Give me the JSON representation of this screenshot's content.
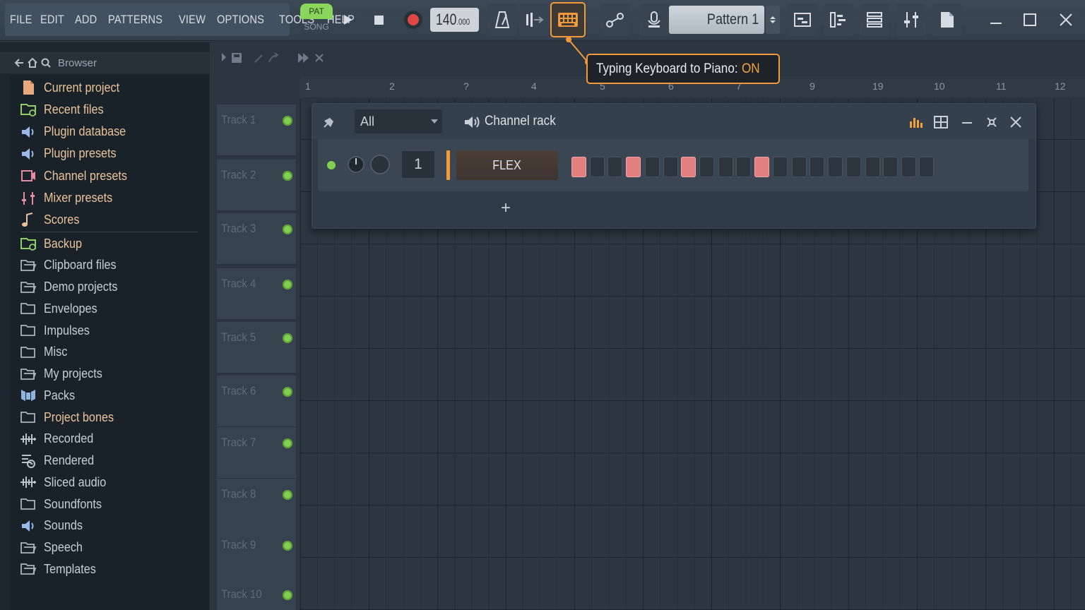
{
  "menu": [
    "FILE",
    "EDIT",
    "ADD",
    "PATTERNS",
    "VIEW",
    "OPTIONS",
    "TOOLS",
    "HELP"
  ],
  "transport": {
    "pat_label": "PAT",
    "song_label": "SONG",
    "tempo_main": "140",
    "tempo_decimal": ".000"
  },
  "pattern": {
    "name": "Pattern 1"
  },
  "hint": {
    "text": "Typing Keyboard to Piano:",
    "state": "ON"
  },
  "browser": {
    "title": "Browser",
    "items": [
      {
        "label": "Current project",
        "icon": "document-icon",
        "tone": "warm"
      },
      {
        "label": "Recent files",
        "icon": "folder-clock-icon",
        "tone": "warm"
      },
      {
        "label": "Plugin database",
        "icon": "speaker-icon",
        "tone": "warm"
      },
      {
        "label": "Plugin presets",
        "icon": "speaker-icon",
        "tone": "warm"
      },
      {
        "label": "Channel presets",
        "icon": "channel-icon",
        "tone": "warm"
      },
      {
        "label": "Mixer presets",
        "icon": "mixer-icon",
        "tone": "warm"
      },
      {
        "label": "Scores",
        "icon": "note-icon",
        "tone": "warm"
      },
      {
        "label": "Backup",
        "icon": "folder-clock-icon",
        "tone": "warm"
      },
      {
        "label": "Clipboard files",
        "icon": "folder-open-icon",
        "tone": "cool"
      },
      {
        "label": "Demo projects",
        "icon": "folder-open-icon",
        "tone": "cool"
      },
      {
        "label": "Envelopes",
        "icon": "folder-icon",
        "tone": "cool"
      },
      {
        "label": "Impulses",
        "icon": "folder-icon",
        "tone": "cool"
      },
      {
        "label": "Misc",
        "icon": "folder-icon",
        "tone": "cool"
      },
      {
        "label": "My projects",
        "icon": "folder-open-icon",
        "tone": "cool"
      },
      {
        "label": "Packs",
        "icon": "packs-icon",
        "tone": "cool"
      },
      {
        "label": "Project bones",
        "icon": "folder-icon",
        "tone": "warm"
      },
      {
        "label": "Recorded",
        "icon": "waveform-icon",
        "tone": "cool"
      },
      {
        "label": "Rendered",
        "icon": "render-icon",
        "tone": "cool"
      },
      {
        "label": "Sliced audio",
        "icon": "waveform-icon",
        "tone": "cool"
      },
      {
        "label": "Soundfonts",
        "icon": "folder-icon",
        "tone": "cool"
      },
      {
        "label": "Sounds",
        "icon": "speaker-icon",
        "tone": "cool"
      },
      {
        "label": "Speech",
        "icon": "folder-open-icon",
        "tone": "cool"
      },
      {
        "label": "Templates",
        "icon": "folder-open-icon",
        "tone": "cool"
      }
    ]
  },
  "playlist": {
    "tracks": [
      "Track 1",
      "Track 2",
      "Track 3",
      "Track 4",
      "Track 5",
      "Track 6",
      "Track 7",
      "Track 8",
      "Track 9",
      "Track 10"
    ],
    "ruler": [
      "1",
      "2",
      "?",
      "4",
      "5",
      "6",
      "7",
      "9",
      "19",
      "10",
      "11",
      "12"
    ]
  },
  "channel_rack": {
    "title": "Channel rack",
    "filter": "All",
    "add_label": "+",
    "channel": {
      "name": "FLEX",
      "route": "1",
      "steps": [
        1,
        0,
        0,
        1,
        0,
        0,
        1,
        0,
        0,
        0,
        1,
        0,
        0,
        0,
        0,
        0,
        0,
        0,
        0,
        0
      ]
    }
  },
  "colors": {
    "accent": "#f29a3b",
    "step_on": "#e27f7f",
    "led_green": "#82d053",
    "pat_green": "#8bd55d",
    "record_red": "#e04646"
  }
}
